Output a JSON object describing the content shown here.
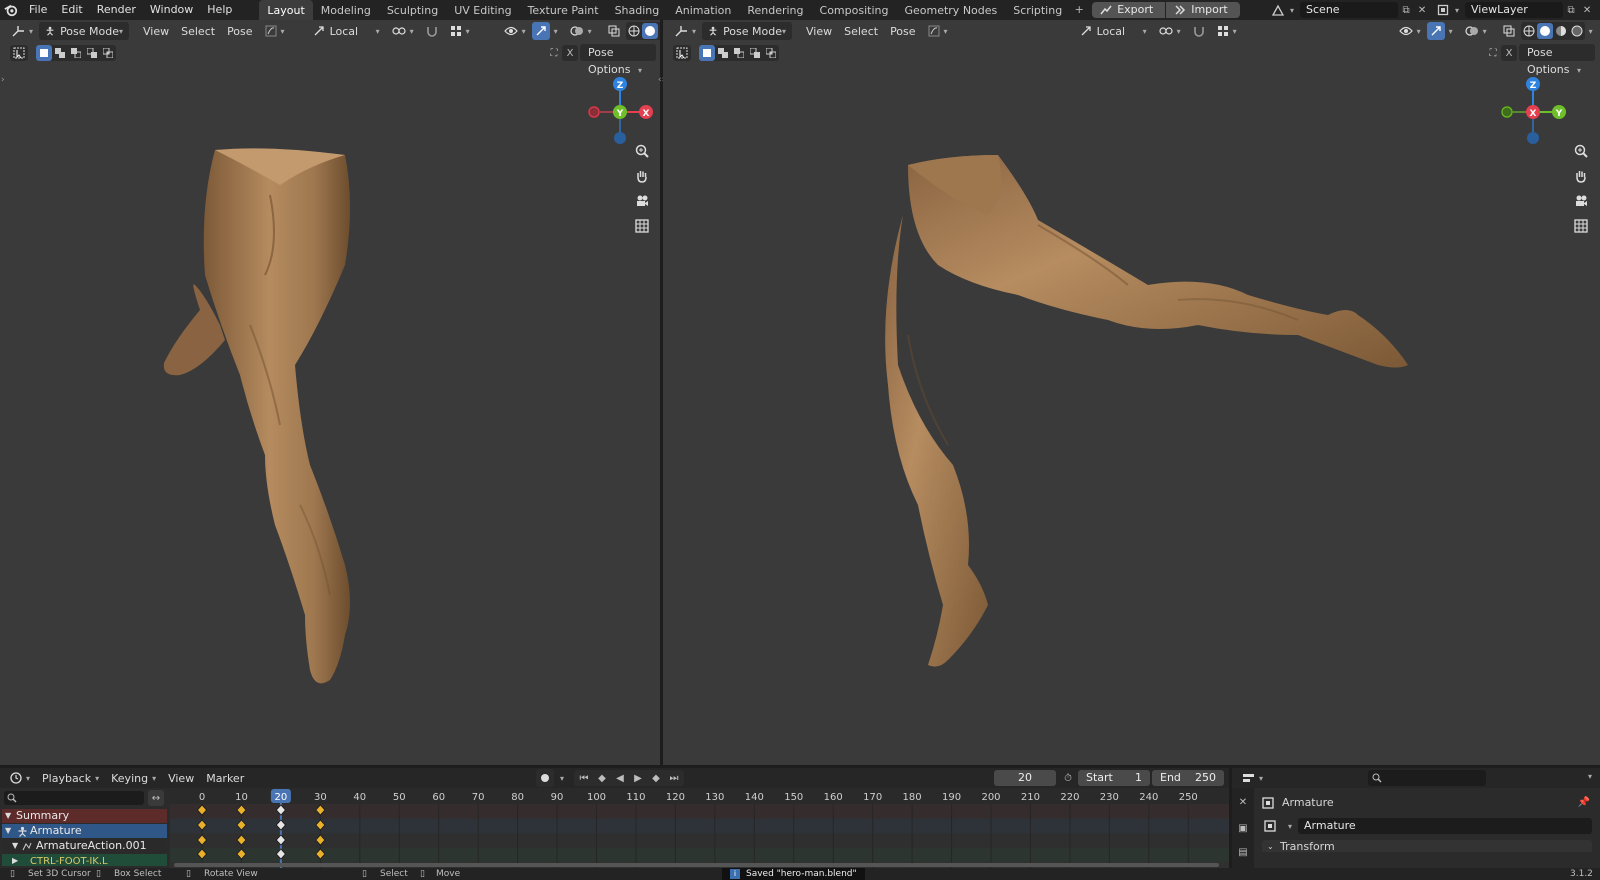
{
  "topbar": {
    "menus": [
      "File",
      "Edit",
      "Render",
      "Window",
      "Help"
    ],
    "workspaces": [
      "Layout",
      "Modeling",
      "Sculpting",
      "UV Editing",
      "Texture Paint",
      "Shading",
      "Animation",
      "Rendering",
      "Compositing",
      "Geometry Nodes",
      "Scripting"
    ],
    "active_workspace": "Layout",
    "export_label": "Export",
    "import_label": "Import",
    "scene": "Scene",
    "view_layer": "ViewLayer"
  },
  "viewport_left": {
    "mode": "Pose Mode",
    "menus": [
      "View",
      "Select",
      "Pose"
    ],
    "orientation": "Local",
    "pose_options": "Pose Options"
  },
  "viewport_right": {
    "mode": "Pose Mode",
    "menus": [
      "View",
      "Select",
      "Pose"
    ],
    "orientation": "Local",
    "pose_options": "Pose Options"
  },
  "gizmo_left": {
    "axes": [
      "Z",
      "Y",
      "X"
    ]
  },
  "gizmo_right": {
    "axes": [
      "Z",
      "X",
      "Y"
    ]
  },
  "timeline": {
    "menus": [
      "Playback",
      "Keying",
      "View",
      "Marker"
    ],
    "current_frame": "20",
    "start_label": "Start",
    "start": "1",
    "end_label": "End",
    "end": "250",
    "ruler": [
      "0",
      "10",
      "20",
      "30",
      "40",
      "50",
      "60",
      "70",
      "80",
      "90",
      "100",
      "110",
      "120",
      "130",
      "140",
      "150",
      "160",
      "170",
      "180",
      "190",
      "200",
      "210",
      "220",
      "230",
      "240",
      "250"
    ],
    "keyframes": [
      0,
      10,
      20,
      30
    ],
    "channels": {
      "summary": "Summary",
      "armature": "Armature",
      "action": "ArmatureAction.001",
      "bone": "CTRL-FOOT-IK.L"
    }
  },
  "properties": {
    "object_name": "Armature",
    "data_name": "Armature",
    "section": "Transform"
  },
  "statusbar": {
    "set_cursor": "Set 3D Cursor",
    "box_select": "Box Select",
    "rotate_view": "Rotate View",
    "select": "Select",
    "move": "Move",
    "message": "Saved \"hero-man.blend\"",
    "version": "3.1.2"
  },
  "colors": {
    "accent": "#4a75b5",
    "skin": "#b48a5e",
    "keyframe": "#e8b02b",
    "axis_x": "#e4404f",
    "axis_y": "#6fbf2a",
    "axis_z": "#2f83e0"
  }
}
